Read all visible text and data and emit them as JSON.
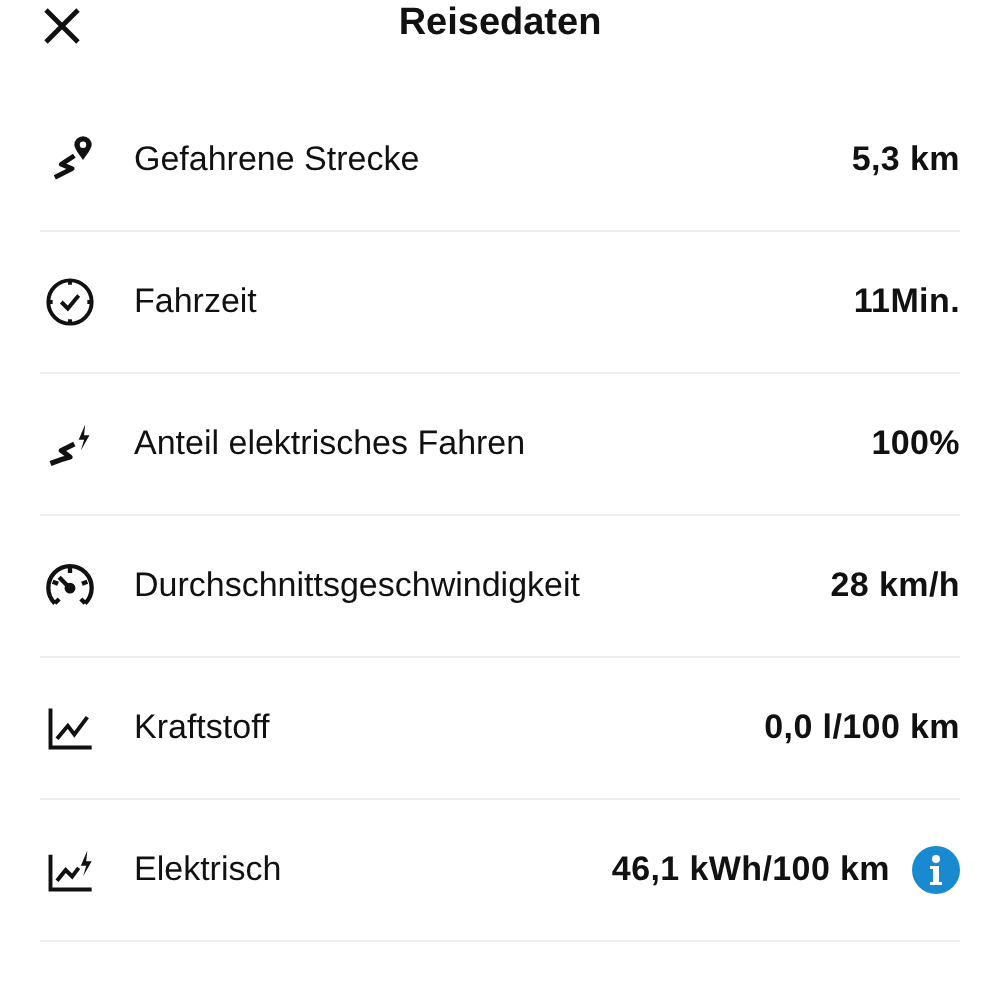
{
  "header": {
    "title": "Reisedaten"
  },
  "rows": [
    {
      "kind": "route",
      "label": "Gefahrene Strecke",
      "value": "5,3 km"
    },
    {
      "kind": "clock",
      "label": "Fahrzeit",
      "value": "11Min."
    },
    {
      "kind": "electric-route",
      "label": "Anteil elektrisches Fahren",
      "value": "100%"
    },
    {
      "kind": "speedometer",
      "label": "Durchschnittsgeschwindigkeit",
      "value": "28 km/h"
    },
    {
      "kind": "chart",
      "label": "Kraftstoff",
      "value": "0,0 l/100 km"
    },
    {
      "kind": "electric-chart",
      "label": "Elektrisch",
      "value": "46,1 kWh/100 km",
      "info": true
    }
  ]
}
